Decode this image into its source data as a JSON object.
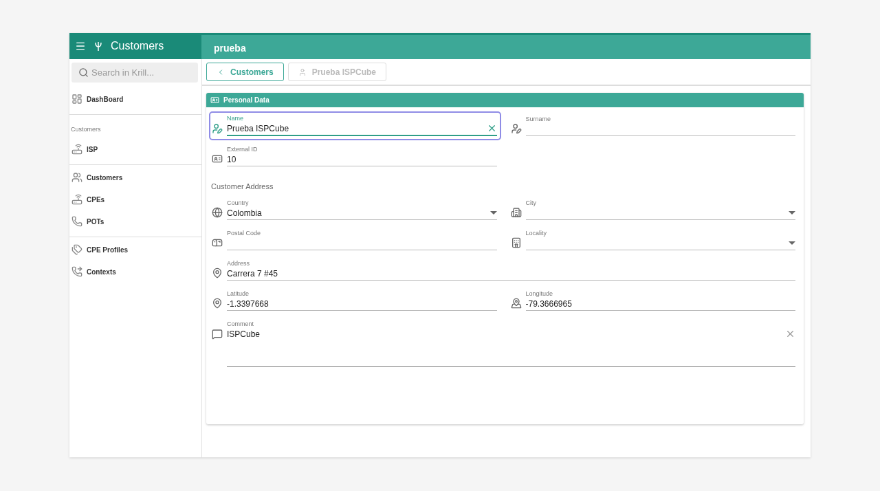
{
  "header": {
    "title": "Customers",
    "search_value": "prueba"
  },
  "sidebar": {
    "search": {
      "placeholder": "Search in Krill..."
    },
    "groups": [
      {
        "items": [
          {
            "label": "DashBoard"
          }
        ]
      },
      {
        "heading": "Customers",
        "items": [
          {
            "label": "ISP"
          }
        ]
      },
      {
        "items": [
          {
            "label": "Customers"
          },
          {
            "label": "CPEs"
          },
          {
            "label": "POTs"
          }
        ]
      },
      {
        "items": [
          {
            "label": "CPE Profiles"
          },
          {
            "label": "Contexts"
          }
        ]
      }
    ]
  },
  "breadcrumbs": [
    {
      "label": "Customers",
      "disabled": false
    },
    {
      "label": "Prueba ISPCube",
      "disabled": true
    }
  ],
  "panel": {
    "title": "Personal Data",
    "rows": [
      {
        "fields": [
          {
            "kind": "text",
            "label": "Name",
            "value": "Prueba ISPCube",
            "focused": true,
            "clearable": true
          },
          {
            "kind": "text",
            "label": "Surname",
            "focused": false,
            "clearable": false
          }
        ]
      },
      {
        "fields": [
          {
            "kind": "text",
            "label": "External ID",
            "value": "10",
            "focused": false,
            "clearable": false
          }
        ]
      },
      {
        "heading": "Customer Address"
      },
      {
        "fields": [
          {
            "kind": "select",
            "label": "Country",
            "value": "Colombia",
            "focused": false,
            "clearable": false
          },
          {
            "kind": "select",
            "label": "City",
            "focused": false,
            "clearable": false
          }
        ]
      },
      {
        "fields": [
          {
            "kind": "text",
            "label": "Postal Code",
            "focused": false,
            "clearable": false
          },
          {
            "kind": "select",
            "label": "Locality",
            "focused": false,
            "clearable": false
          }
        ]
      },
      {
        "fields": [
          {
            "kind": "text",
            "label": "Address",
            "value": "Carrera 7 #45",
            "wide": true,
            "focused": false,
            "clearable": false
          }
        ]
      },
      {
        "fields": [
          {
            "kind": "text",
            "label": "Latitude",
            "value": "-1.3397668",
            "focused": false,
            "clearable": false
          },
          {
            "kind": "text",
            "label": "Longitude",
            "value": "-79.3666965",
            "focused": false,
            "clearable": false
          }
        ]
      },
      {
        "fields": [
          {
            "kind": "textarea",
            "label": "Comment",
            "value": "ISPCube",
            "wide": true,
            "focused": false,
            "clearable": true
          }
        ]
      }
    ]
  }
}
